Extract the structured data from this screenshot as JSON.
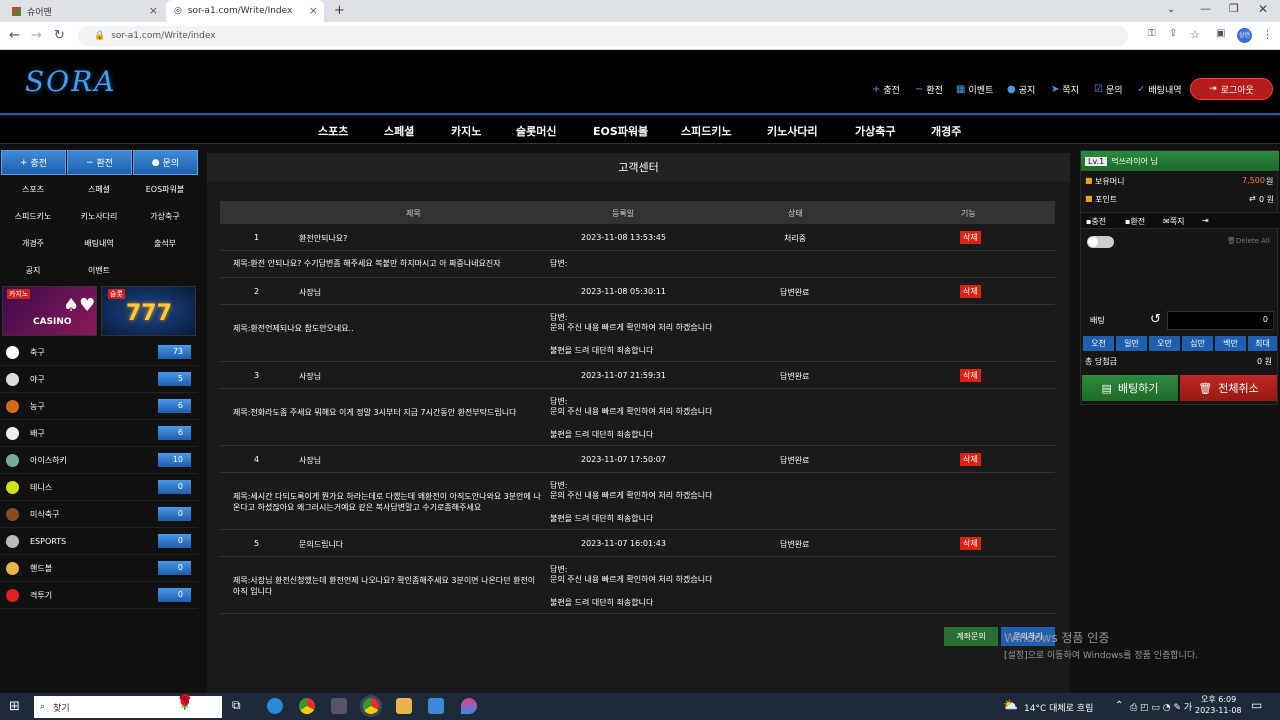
{
  "browser": {
    "tabs": [
      {
        "label": "슈어맨"
      },
      {
        "label": "sor-a1.com/Write/Index"
      }
    ],
    "url": "sor-a1.com/Write/index"
  },
  "site": {
    "logo": "SORA",
    "top_links": [
      {
        "icon": "plus-icon",
        "label": "충전"
      },
      {
        "icon": "minus-icon",
        "label": "환전"
      },
      {
        "icon": "calendar-icon",
        "label": "이벤트"
      },
      {
        "icon": "info-icon",
        "label": "공지"
      },
      {
        "icon": "send-icon",
        "label": "쪽지"
      },
      {
        "icon": "check-box-icon",
        "label": "문의"
      },
      {
        "icon": "check-icon",
        "label": "배팅내역"
      }
    ],
    "logout": "로그아웃",
    "main_menu": [
      "스포츠",
      "스페셜",
      "카지노",
      "슬롯머신",
      "EOS파워볼",
      "스피드키노",
      "키노사다리",
      "가상축구",
      "개경주"
    ]
  },
  "left": {
    "buttons": [
      "충전",
      "환전",
      "문의"
    ],
    "grid": [
      "스포츠",
      "스페셜",
      "EOS파워볼",
      "스피드키노",
      "키노사다리",
      "가상축구",
      "개경주",
      "배팅내역",
      "출석부",
      "공지",
      "이벤트"
    ],
    "banners": [
      {
        "tag": "카지노",
        "text": "CASINO"
      },
      {
        "tag": "슬롯",
        "text": "777"
      }
    ],
    "sports": [
      {
        "name": "축구",
        "count": "73",
        "color": "#fff"
      },
      {
        "name": "야구",
        "count": "5",
        "color": "#ddd"
      },
      {
        "name": "농구",
        "count": "6",
        "color": "#d56a1b"
      },
      {
        "name": "배구",
        "count": "6",
        "color": "#eee"
      },
      {
        "name": "아이스하키",
        "count": "10",
        "color": "#7a9"
      },
      {
        "name": "테니스",
        "count": "0",
        "color": "#cde21b"
      },
      {
        "name": "미식축구",
        "count": "0",
        "color": "#8b4a1f"
      },
      {
        "name": "ESPORTS",
        "count": "0",
        "color": "#bbb"
      },
      {
        "name": "핸드볼",
        "count": "0",
        "color": "#e8b44a"
      },
      {
        "name": "격투기",
        "count": "0",
        "color": "#d22"
      }
    ]
  },
  "center": {
    "title": "고객센터",
    "headers": [
      "제목",
      "등록일",
      "상태",
      "기능"
    ],
    "rows": [
      {
        "num": "1",
        "title": "환전안되나요?",
        "date": "2023-11-08 13:53:45",
        "status": "처리중",
        "del": "삭제",
        "q": "제목:환전 안되나요? 수기답변좀 해주세요 복붙만 하지마시고 아 짜증나네요진자",
        "answer": [
          "답변:"
        ]
      },
      {
        "num": "2",
        "title": "사장님",
        "date": "2023-11-08 05:30:11",
        "status": "답변완료",
        "del": "삭제",
        "q": "제목:환전언제되나요 참도안오네요..",
        "answer": [
          "답변:",
          "문의 주신 내용 빠르게 확인하여 처리 하겠습니다",
          "불편을 드려 대단히 죄송합니다"
        ]
      },
      {
        "num": "3",
        "title": "사장님",
        "date": "2023-11-07 21:59:31",
        "status": "답변완료",
        "del": "삭제",
        "q": "제목:전화라도좀 주세요 뭐해요 이게 정말 3시부터 지금 7시간동안 환전부탁드립니다",
        "answer": [
          "답변:",
          "문의 주신 내용 빠르게 확인하여 처리 하겠습니다",
          "불편을 드려 대단히 죄송합니다"
        ]
      },
      {
        "num": "4",
        "title": "사장님",
        "date": "2023-11-07 17:50:07",
        "status": "답변완료",
        "del": "삭제",
        "q": "제목:세시간 다되도록이게 뭔가요 하라는데로 다했는데 왜환전이 아직도안나와요 3분안에 나온다고 하셨잖아요 왜그러시는거예요 같은 복사답변말고 수기로좀해주세요",
        "answer": [
          "답변:",
          "문의 주신 내용 빠르게 확인하여 처리 하겠습니다",
          "불편을 드려 대단히 죄송합니다"
        ]
      },
      {
        "num": "5",
        "title": "문의드립니다",
        "date": "2023-11-07 16:01:43",
        "status": "답변완료",
        "del": "삭제",
        "q": "제목:사장님 환전신청했는데 환전언제 나오나요? 확인좀해주세요 3분이면 나온다던 환전이 아직 입니다",
        "answer": [
          "답변:",
          "문의 주신 내용 빠르게 확인하여 처리 하겠습니다",
          "불편을 드려 대단히 죄송합니다"
        ]
      }
    ],
    "btn_account": "계좌문의",
    "btn_inquiry": "문의하기"
  },
  "right": {
    "level": "Lv.1",
    "user": "먹쓰라이어 님",
    "money_label": "보유머니",
    "money": "7,500",
    "money_unit": "원",
    "point_label": "포인트",
    "point": "0 원",
    "tabs": [
      "충전",
      "환전",
      "쪽지"
    ],
    "delete_all": "Delete All",
    "bet_label": "배팅",
    "bet_value": "0",
    "amounts": [
      "오천",
      "일만",
      "오만",
      "십만",
      "백만",
      "최대"
    ],
    "total_label": "총 당첨금",
    "total": "0 원",
    "bet_button": "배팅하기",
    "cancel_button": "전체취소"
  },
  "watermark": {
    "line1": "Windows 정품 인증",
    "line2": "[설정]으로 이동하여 Windows를 정품 인증합니다."
  },
  "taskbar": {
    "search": "찾기",
    "weather": "14°C 대체로 흐림",
    "time": "오후 6:09",
    "date": "2023-11-08"
  }
}
